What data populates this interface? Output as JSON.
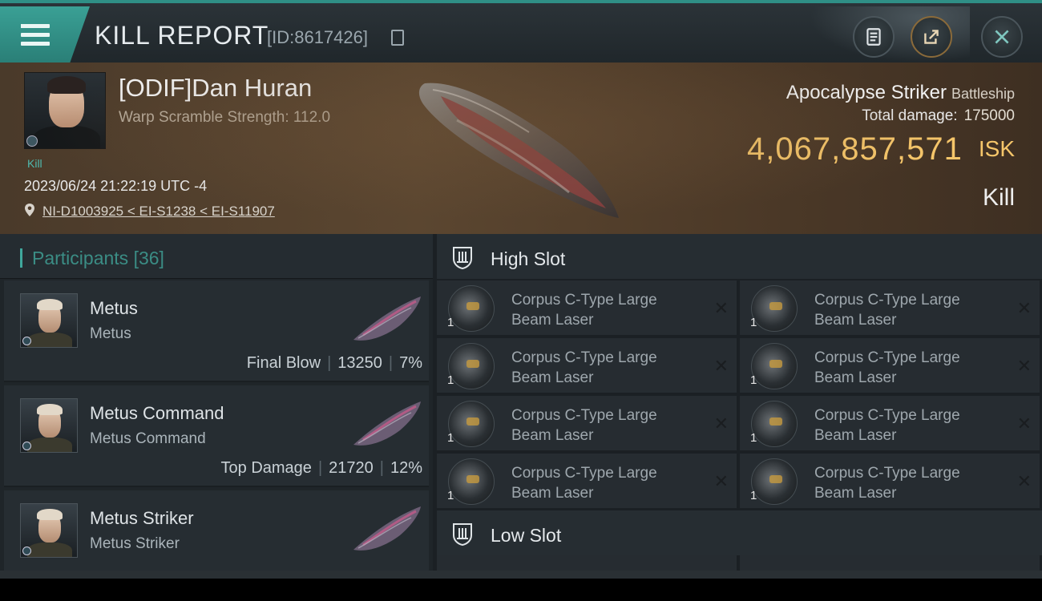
{
  "header": {
    "title": "KILL REPORT",
    "id_text": "[ID:8617426]",
    "buttons": [
      "report-icon",
      "share-icon",
      "close-icon"
    ]
  },
  "victim": {
    "name": "[ODIF]Dan Huran",
    "stat": "Warp Scramble Strength: 112.0",
    "tag": "Kill",
    "datetime": "2023/06/24 21:22:19 UTC -4",
    "location": "NI-D1003925 < EI-S1238 < EI-S11907",
    "ship_name": "Apocalypse Striker",
    "ship_class": "Battleship",
    "damage_label": "Total damage:",
    "damage_value": "175000",
    "isk_value": "4,067,857,571",
    "isk_unit": "ISK",
    "result": "Kill"
  },
  "participants": {
    "label": "Participants",
    "count": "[36]",
    "rows": [
      {
        "name": "Metus",
        "corp": "Metus",
        "role": "Final Blow",
        "damage": "13250",
        "pct": "7%"
      },
      {
        "name": "Metus Command",
        "corp": "Metus Command",
        "role": "Top Damage",
        "damage": "21720",
        "pct": "12%"
      },
      {
        "name": "Metus Striker",
        "corp": "Metus Striker",
        "role": "",
        "damage": "",
        "pct": ""
      }
    ]
  },
  "slots": {
    "high_label": "High Slot",
    "low_label": "Low Slot",
    "high_items": [
      {
        "line1": "Corpus C-Type Large",
        "line2": "Beam Laser",
        "qty": "1"
      },
      {
        "line1": "Corpus C-Type Large",
        "line2": "Beam Laser",
        "qty": "1"
      },
      {
        "line1": "Corpus C-Type Large",
        "line2": "Beam Laser",
        "qty": "1"
      },
      {
        "line1": "Corpus C-Type Large",
        "line2": "Beam Laser",
        "qty": "1"
      },
      {
        "line1": "Corpus C-Type Large",
        "line2": "Beam Laser",
        "qty": "1"
      },
      {
        "line1": "Corpus C-Type Large",
        "line2": "Beam Laser",
        "qty": "1"
      },
      {
        "line1": "Corpus C-Type Large",
        "line2": "Beam Laser",
        "qty": "1"
      },
      {
        "line1": "Corpus C-Type Large",
        "line2": "Beam Laser",
        "qty": "1"
      }
    ],
    "remove_glyph": "✕"
  },
  "colors": {
    "accent": "#3fa79c",
    "isk": "#f6c66a"
  }
}
